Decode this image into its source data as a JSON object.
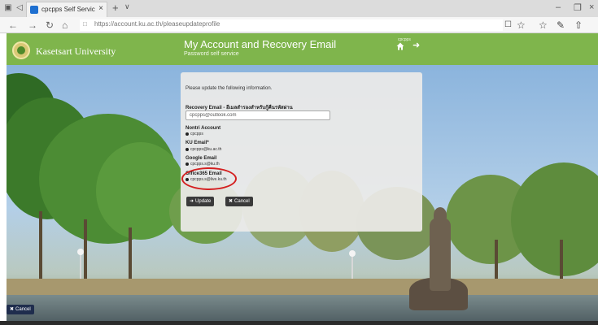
{
  "browser": {
    "tab_title": "cpcpps Self Service Pass",
    "tab_close": "×",
    "new_tab": "+",
    "tab_menu": "∨",
    "url": "https://account.ku.ac.th/pleaseupdateprofile",
    "window_controls": {
      "minimize": "–",
      "restore": "❐",
      "close": "×"
    },
    "nav": {
      "back": "←",
      "forward": "→",
      "refresh": "↻",
      "home": "⌂"
    },
    "right_icons": {
      "reading": "☐",
      "favorite": "☆",
      "favorites_bar": "☆",
      "pen": "✎",
      "share": "⇧"
    }
  },
  "header": {
    "university_name": "Kasetsart University",
    "page_title": "My Account and Recovery Email",
    "page_subtitle": "Password self service",
    "user_label": "cpcpps",
    "signout_glyph": "➜"
  },
  "form": {
    "intro": "Please update the following information.",
    "recovery_label": "Recovery Email - อีเมลสำรองสำหรับกู้คืนรหัสผ่าน",
    "recovery_value": "cpcpps@outlook.com",
    "nontri_label": "Nontri Account",
    "nontri_value": "cpcpps",
    "ku_email_label": "KU Email*",
    "ku_email_value": "cpcpps@ku.ac.th",
    "google_label": "Google Email",
    "google_value": "cpcpps.s@ku.th",
    "office_label": "Office365 Email",
    "office_value": "cpcpps.s@live.ku.th",
    "update_button": "Update",
    "update_glyph": "➜",
    "cancel_button": "Cancel",
    "cancel_glyph": "✖"
  },
  "footer": {
    "cancel_button": "Cancel",
    "cancel_glyph": "✖"
  },
  "colors": {
    "header_green": "#7fb54c",
    "highlight_red": "#d42020",
    "button_dark": "#3a3a3a"
  }
}
